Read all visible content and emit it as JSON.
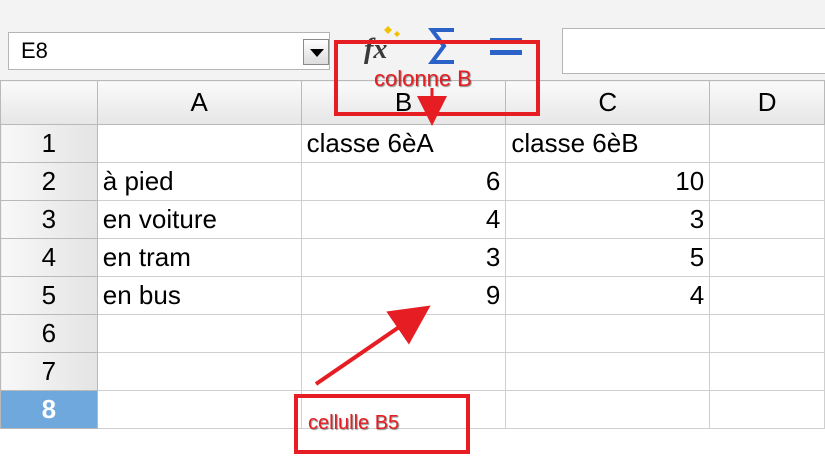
{
  "name_box": {
    "value": "E8"
  },
  "toolbar": {
    "function_wizard": "fx-icon",
    "sum": "sigma-icon",
    "formula": "equals-icon"
  },
  "formula_bar": {
    "value": ""
  },
  "columns": [
    "",
    "A",
    "B",
    "C",
    "D"
  ],
  "rows": [
    {
      "num": "1",
      "a": "",
      "b": "classe 6èA",
      "c": "classe 6èB"
    },
    {
      "num": "2",
      "a": "à pied",
      "b": "6",
      "c": "10"
    },
    {
      "num": "3",
      "a": "en voiture",
      "b": "4",
      "c": "3"
    },
    {
      "num": "4",
      "a": "en tram",
      "b": "3",
      "c": "5"
    },
    {
      "num": "5",
      "a": "en bus",
      "b": "9",
      "c": "4"
    },
    {
      "num": "6",
      "a": "",
      "b": "",
      "c": ""
    },
    {
      "num": "7",
      "a": "",
      "b": "",
      "c": ""
    },
    {
      "num": "8",
      "a": "",
      "b": "",
      "c": ""
    }
  ],
  "active_row": "8",
  "annotations": {
    "column_b": "colonne B",
    "cell_b5": "cellulle B5",
    "color": "#e61e24"
  },
  "colors": {
    "active_row_header": "#6fa8dc",
    "grid_line": "#cfcfcf"
  }
}
